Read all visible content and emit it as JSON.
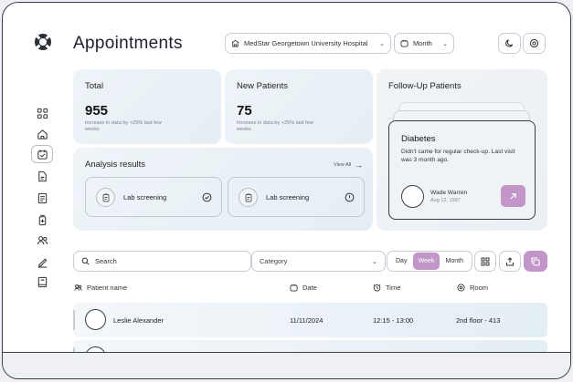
{
  "header": {
    "title": "Appointments",
    "hospital_select": "MedStar Georgetown University Hospital",
    "period_select": "Month"
  },
  "stats": {
    "total": {
      "label": "Total",
      "value": "955",
      "note": "Increase in data by +25% last few weeks"
    },
    "new_patients": {
      "label": "New Patients",
      "value": "75",
      "note": "Increase in data by +25% last few weeks"
    }
  },
  "analysis": {
    "title": "Analysis results",
    "view_all": "View All",
    "items": [
      {
        "label": "Lab screening",
        "status": "done"
      },
      {
        "label": "Lab screening",
        "status": "pending"
      }
    ]
  },
  "follow_up": {
    "title": "Follow-Up Patients",
    "card": {
      "diagnosis": "Diabetes",
      "message": "Didn't came for regular check-up. Last visit was 3 month ago.",
      "patient_name": "Wade Warren",
      "patient_dob": "Aug 12, 1987"
    },
    "accent_color": "#c296c9"
  },
  "toolbar": {
    "search_placeholder": "Search",
    "category_placeholder": "Category",
    "view_tabs": [
      "Day",
      "Week",
      "Month"
    ],
    "active_view": "Week"
  },
  "table": {
    "columns": [
      "Patient name",
      "Date",
      "Time",
      "Room"
    ],
    "rows": [
      {
        "name": "Leslie Alexander",
        "date": "11/11/2024",
        "time": "12:15 - 13:00",
        "room": "2nd floor - 413"
      }
    ]
  },
  "icons": {
    "sidebar": [
      "grid-icon",
      "home-icon",
      "calendar-icon",
      "document-icon",
      "report-icon",
      "medicine-icon",
      "users-icon",
      "pen-icon",
      "book-icon"
    ]
  }
}
